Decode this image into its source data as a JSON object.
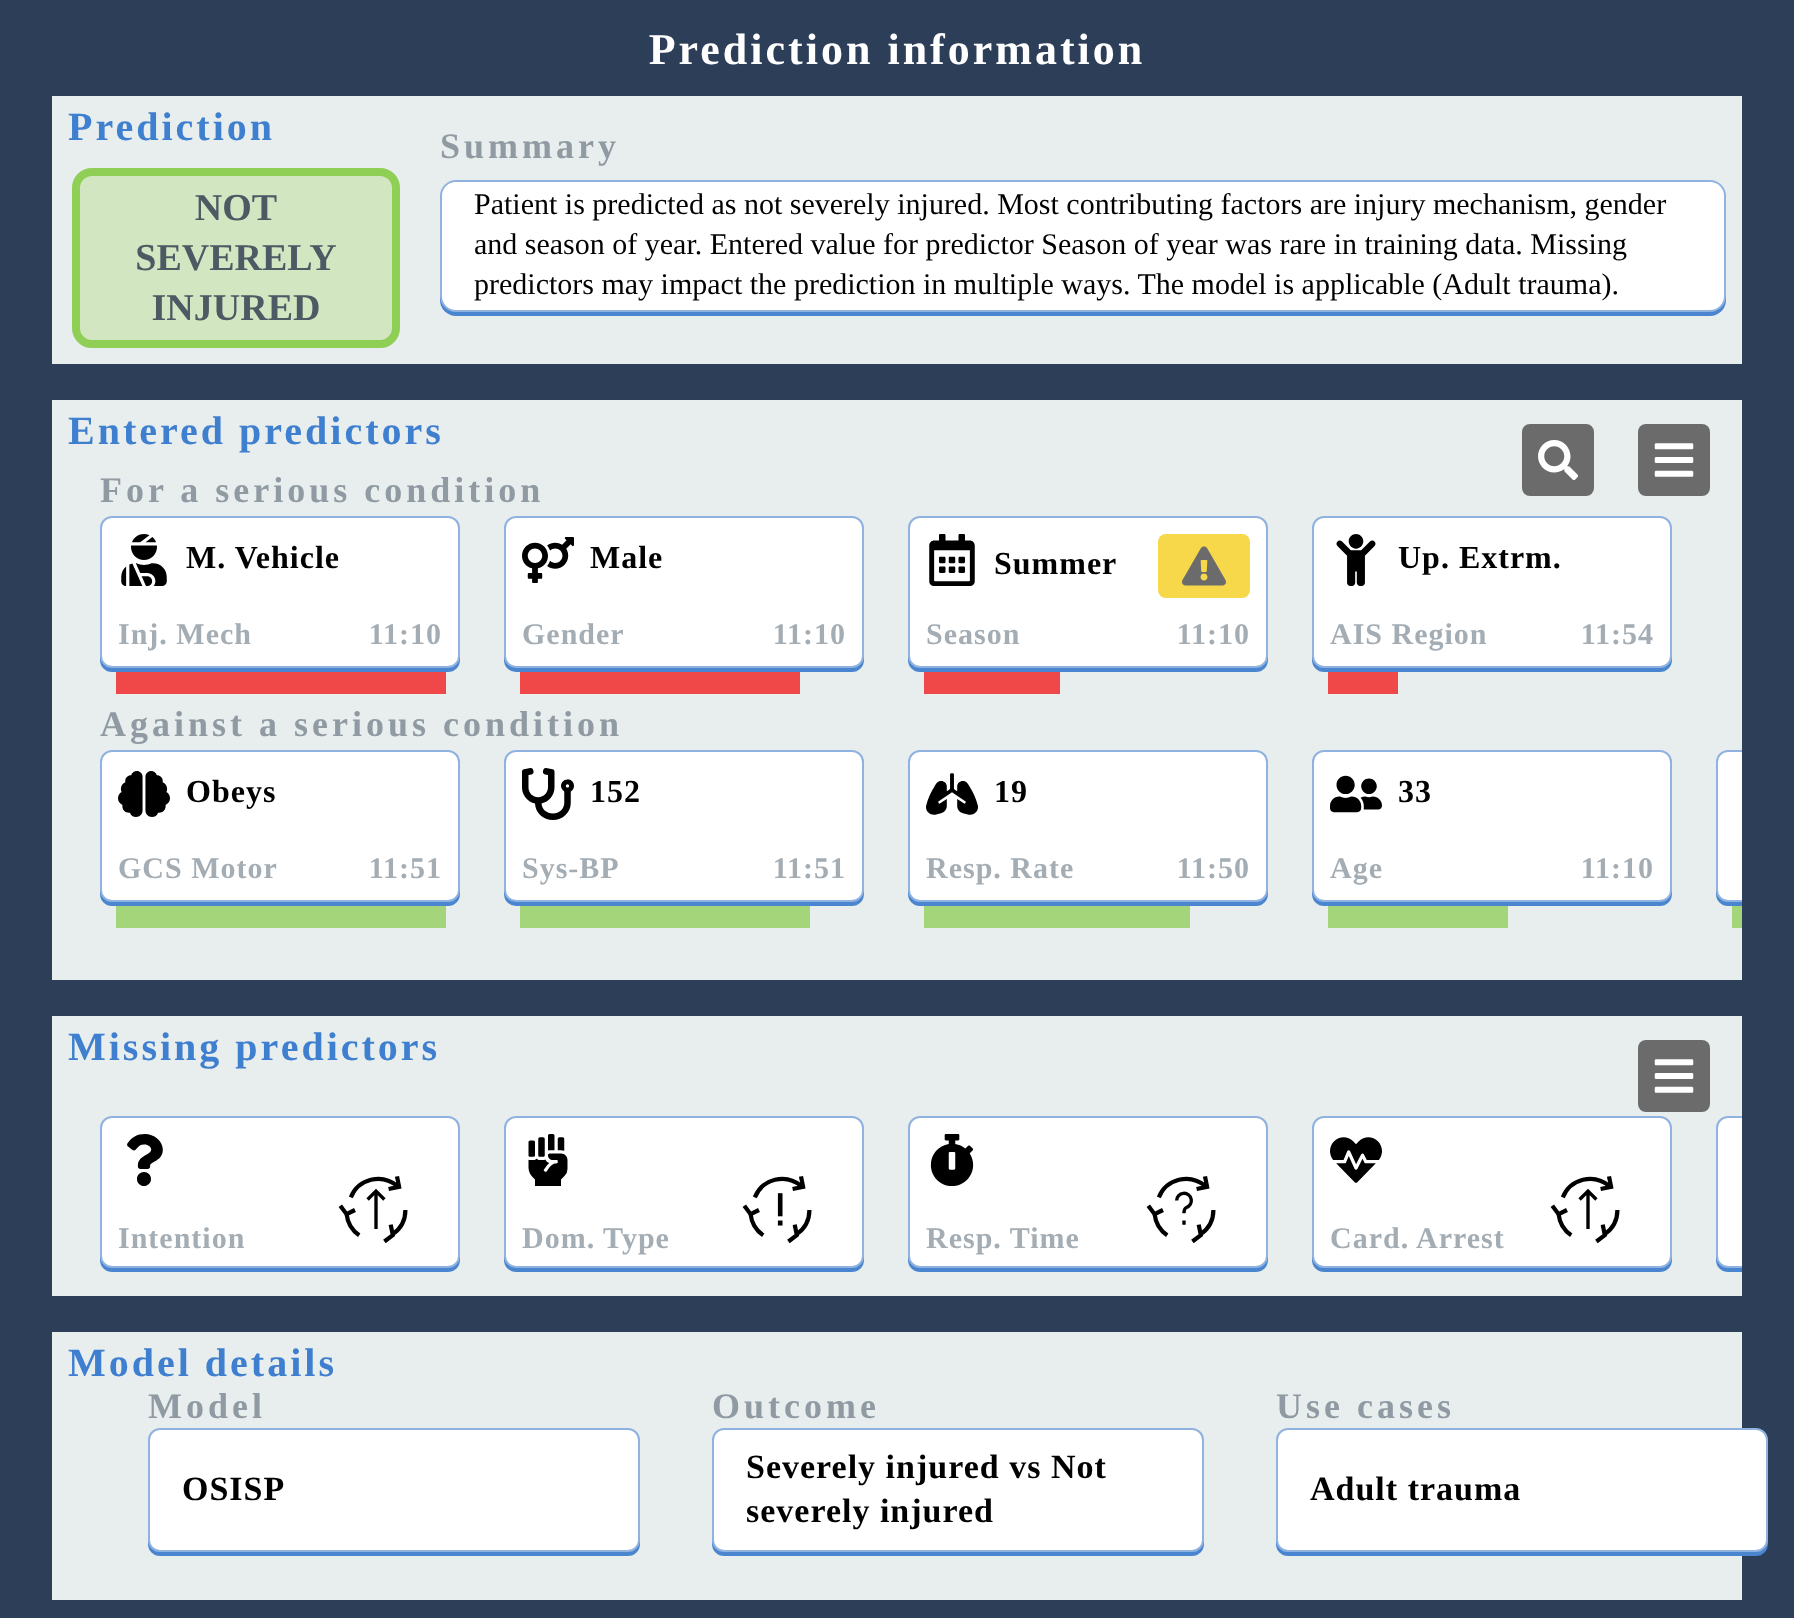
{
  "title": "Prediction information",
  "prediction": {
    "heading": "Prediction",
    "result": "NOT SEVERELY INJURED",
    "summary_label": "Summary",
    "summary": "Patient is predicted as not severely injured. Most contributing factors are injury mechanism, gender and season of year. Entered value for predictor Season of year was rare in training data. Missing predictors may impact the prediction in multiple ways. The model is applicable (Adult trauma)."
  },
  "entered": {
    "heading": "Entered predictors",
    "groups": [
      {
        "label": "For a serious condition",
        "kind": "for",
        "items": [
          {
            "kind": "card",
            "value": "M. Vehicle",
            "label": "Inj. Mech",
            "time": "11:10",
            "warning": false
          },
          {
            "kind": "card",
            "value": "Male",
            "label": "Gender",
            "time": "11:10",
            "warning": false
          },
          {
            "kind": "card",
            "value": "Summer",
            "label": "Season",
            "time": "11:10",
            "warning": true
          },
          {
            "kind": "card",
            "value": "Up. Extrm.",
            "label": "AIS Region",
            "time": "11:54",
            "warning": false
          }
        ]
      },
      {
        "label": "Against a serious condition",
        "kind": "against",
        "items": [
          {
            "kind": "card",
            "value": "Obeys",
            "label": "GCS Motor",
            "time": "11:51",
            "warning": false
          },
          {
            "kind": "card",
            "value": "152",
            "label": "Sys-BP",
            "time": "11:51",
            "warning": false
          },
          {
            "kind": "card",
            "value": "19",
            "label": "Resp. Rate",
            "time": "11:50",
            "warning": false
          },
          {
            "kind": "card",
            "value": "33",
            "label": "Age",
            "time": "11:10",
            "warning": false
          },
          {
            "kind": "partial"
          }
        ]
      }
    ]
  },
  "missing": {
    "heading": "Missing predictors",
    "items": [
      {
        "kind": "up",
        "label": "Intention"
      },
      {
        "kind": "alert",
        "label": "Dom. Type"
      },
      {
        "kind": "unknown",
        "label": "Resp. Time"
      },
      {
        "kind": "up",
        "label": "Card. Arrest"
      },
      {
        "kind": "partial"
      }
    ]
  },
  "model": {
    "heading": "Model details",
    "fields": [
      {
        "label": "Model",
        "value": "OSISP"
      },
      {
        "label": "Outcome",
        "value": "Severely injured vs Not severely injured"
      },
      {
        "label": "Use cases",
        "value": "Adult trauma"
      }
    ]
  }
}
